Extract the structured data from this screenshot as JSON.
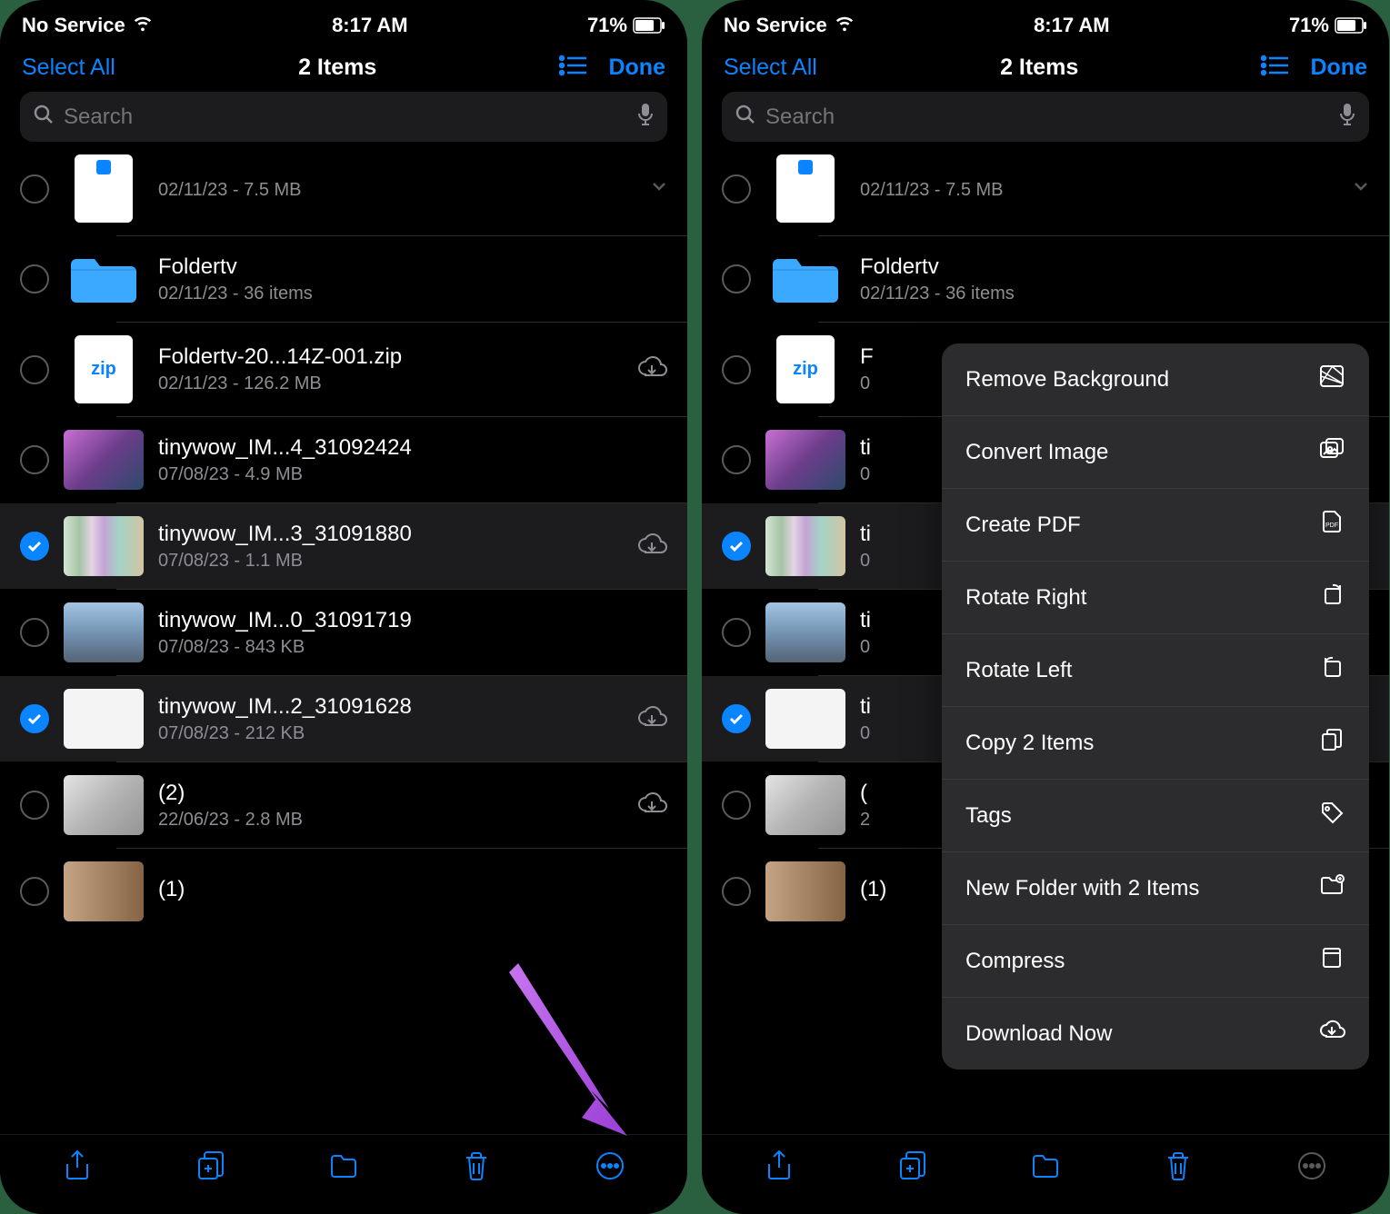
{
  "status": {
    "service": "No Service",
    "time": "8:17 AM",
    "battery": "71%"
  },
  "nav": {
    "select_all": "Select All",
    "title": "2 Items",
    "done": "Done"
  },
  "search": {
    "placeholder": "Search"
  },
  "files": [
    {
      "name": "",
      "meta": "02/11/23 - 7.5 MB",
      "thumb": "docblue",
      "selected": false,
      "cloud": false,
      "chevron": true
    },
    {
      "name": "Foldertv",
      "meta": "02/11/23 - 36 items",
      "thumb": "folder",
      "selected": false,
      "cloud": false,
      "chevron": false
    },
    {
      "name": "Foldertv-20...14Z-001.zip",
      "meta": "02/11/23 - 126.2 MB",
      "thumb": "zip",
      "selected": false,
      "cloud": true,
      "chevron": false
    },
    {
      "name": "tinywow_IM...4_31092424",
      "meta": "07/08/23 - 4.9 MB",
      "thumb": "photo1",
      "selected": false,
      "cloud": false,
      "chevron": false
    },
    {
      "name": "tinywow_IM...3_31091880",
      "meta": "07/08/23 - 1.1 MB",
      "thumb": "photo2",
      "selected": true,
      "cloud": true,
      "chevron": false
    },
    {
      "name": "tinywow_IM...0_31091719",
      "meta": "07/08/23 - 843 KB",
      "thumb": "photo3",
      "selected": false,
      "cloud": false,
      "chevron": false
    },
    {
      "name": "tinywow_IM...2_31091628",
      "meta": "07/08/23 - 212 KB",
      "thumb": "photo4",
      "selected": true,
      "cloud": true,
      "chevron": false
    },
    {
      "name": "(2)",
      "meta": "22/06/23 - 2.8 MB",
      "thumb": "photo5",
      "selected": false,
      "cloud": true,
      "chevron": false
    },
    {
      "name": "(1)",
      "meta": "",
      "thumb": "photo6",
      "selected": false,
      "cloud": false,
      "chevron": false
    }
  ],
  "files_right": [
    {
      "name": "",
      "meta": "02/11/23 - 7.5 MB",
      "thumb": "docblue",
      "selected": false,
      "cloud": false,
      "chevron": true
    },
    {
      "name": "Foldertv",
      "meta": "02/11/23 - 36 items",
      "thumb": "folder",
      "selected": false,
      "cloud": false,
      "chevron": false
    },
    {
      "name": "F",
      "meta": "0",
      "thumb": "zip",
      "selected": false,
      "cloud": false,
      "chevron": false
    },
    {
      "name": "ti",
      "meta": "0",
      "thumb": "photo1",
      "selected": false,
      "cloud": false,
      "chevron": false
    },
    {
      "name": "ti",
      "meta": "0",
      "thumb": "photo2",
      "selected": true,
      "cloud": false,
      "chevron": false
    },
    {
      "name": "ti",
      "meta": "0",
      "thumb": "photo3",
      "selected": false,
      "cloud": false,
      "chevron": false
    },
    {
      "name": "ti",
      "meta": "0",
      "thumb": "photo4",
      "selected": true,
      "cloud": false,
      "chevron": false
    },
    {
      "name": "(",
      "meta": "2",
      "thumb": "photo5",
      "selected": false,
      "cloud": false,
      "chevron": false
    },
    {
      "name": "(1)",
      "meta": "",
      "thumb": "photo6",
      "selected": false,
      "cloud": false,
      "chevron": false
    }
  ],
  "menu": [
    {
      "label": "Remove Background",
      "icon": "remove-bg"
    },
    {
      "label": "Convert Image",
      "icon": "convert"
    },
    {
      "label": "Create PDF",
      "icon": "pdf"
    },
    {
      "label": "Rotate Right",
      "icon": "rotate-r"
    },
    {
      "label": "Rotate Left",
      "icon": "rotate-l"
    },
    {
      "label": "Copy 2 Items",
      "icon": "copy"
    },
    {
      "label": "Tags",
      "icon": "tag"
    },
    {
      "label": "New Folder with 2 Items",
      "icon": "newfolder"
    },
    {
      "label": "Compress",
      "icon": "compress"
    },
    {
      "label": "Download Now",
      "icon": "download"
    }
  ]
}
